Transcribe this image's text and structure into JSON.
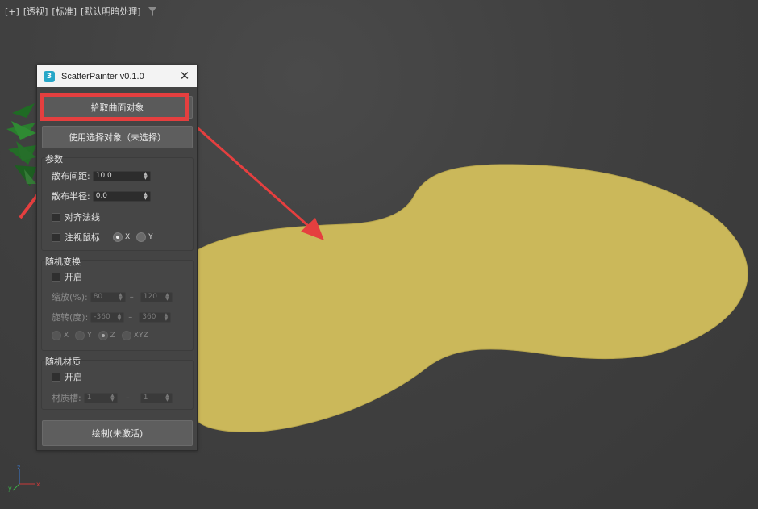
{
  "viewport": {
    "labels": [
      "[+]",
      "[透视]",
      "[标准]",
      "[默认明暗处理]"
    ],
    "filter_icon": "funnel-icon",
    "blob_color": "#cbb85a",
    "axes": {
      "x": "x",
      "y": "y",
      "z": "z"
    }
  },
  "dialog": {
    "title": "ScatterPainter v0.1.0",
    "app_icon": "3",
    "close_icon": "close-icon",
    "pick_surface_button": "拾取曲面对象",
    "use_selection_button": "使用选择对象（未选择）",
    "params": {
      "title": "参数",
      "spacing_label": "散布间距:",
      "spacing_value": "10.0",
      "radius_label": "散布半径:",
      "radius_value": "0.0",
      "align_normal_label": "对齐法线",
      "look_at_mouse_label": "注视鼠标",
      "axis_options": [
        "X",
        "Y"
      ],
      "axis_selected": "X"
    },
    "random_transform": {
      "title": "随机变换",
      "enable_label": "开启",
      "scale_label": "缩放(%):",
      "scale_min": "80",
      "scale_max": "120",
      "rotate_label": "旋转(度):",
      "rotate_min": "-360",
      "rotate_max": "360",
      "axis_options": [
        "X",
        "Y",
        "Z",
        "XYZ"
      ],
      "axis_selected": "Z"
    },
    "random_material": {
      "title": "随机材质",
      "enable_label": "开启",
      "slot_label": "材质槽:",
      "slot_min": "1",
      "slot_max": "1"
    },
    "draw_button": "绘制(未激活)"
  },
  "annotation": {
    "highlight_color": "#e53f3f"
  }
}
